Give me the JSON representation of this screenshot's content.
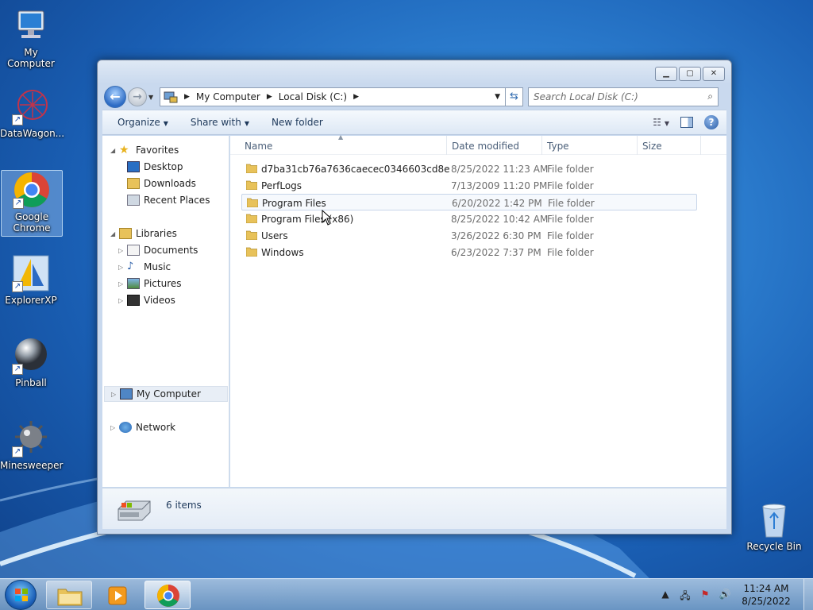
{
  "desktop": {
    "icons": [
      {
        "label": "My Computer"
      },
      {
        "label": "DataWagon..."
      },
      {
        "label": "Google Chrome"
      },
      {
        "label": "ExplorerXP"
      },
      {
        "label": "Pinball"
      },
      {
        "label": "Minesweeper"
      },
      {
        "label": "Recycle Bin"
      }
    ]
  },
  "window": {
    "breadcrumb": [
      "My Computer",
      "Local Disk (C:)"
    ],
    "search_placeholder": "Search Local Disk (C:)",
    "toolbar": {
      "organize": "Organize",
      "share_with": "Share with",
      "new_folder": "New folder"
    },
    "nav": {
      "favorites": "Favorites",
      "desktop": "Desktop",
      "downloads": "Downloads",
      "recent_places": "Recent Places",
      "libraries": "Libraries",
      "documents": "Documents",
      "music": "Music",
      "pictures": "Pictures",
      "videos": "Videos",
      "my_computer": "My Computer",
      "network": "Network"
    },
    "columns": {
      "name": "Name",
      "date_modified": "Date modified",
      "type": "Type",
      "size": "Size"
    },
    "files": [
      {
        "name": "d7ba31cb76a7636caecec0346603cd8e",
        "date": "8/25/2022 11:23 AM",
        "type": "File folder"
      },
      {
        "name": "PerfLogs",
        "date": "7/13/2009 11:20 PM",
        "type": "File folder"
      },
      {
        "name": "Program Files",
        "date": "6/20/2022 1:42 PM",
        "type": "File folder"
      },
      {
        "name": "Program Files (x86)",
        "date": "8/25/2022 10:42 AM",
        "type": "File folder"
      },
      {
        "name": "Users",
        "date": "3/26/2022 6:30 PM",
        "type": "File folder"
      },
      {
        "name": "Windows",
        "date": "6/23/2022 7:37 PM",
        "type": "File folder"
      }
    ],
    "details": {
      "item_count": "6 items"
    }
  },
  "taskbar": {
    "time": "11:24 AM",
    "date": "8/25/2022"
  },
  "colors": {
    "folder": "#e8c25a",
    "accent": "#2c6bc4"
  }
}
